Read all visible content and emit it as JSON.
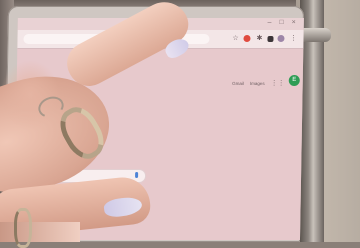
{
  "browser": {
    "top_links": [
      "Gmail",
      "Images"
    ],
    "avatar_letter": "E",
    "window_controls": [
      "–",
      "□",
      "×"
    ],
    "toolbar_icons": [
      "bookmark-star-icon",
      "red-extension-icon",
      "puzzle-extensions-icon",
      "dark-extension-icon",
      "purple-extension-icon",
      "menu-dots-icon"
    ]
  },
  "shortcuts": {
    "sheets_letter": "+"
  }
}
